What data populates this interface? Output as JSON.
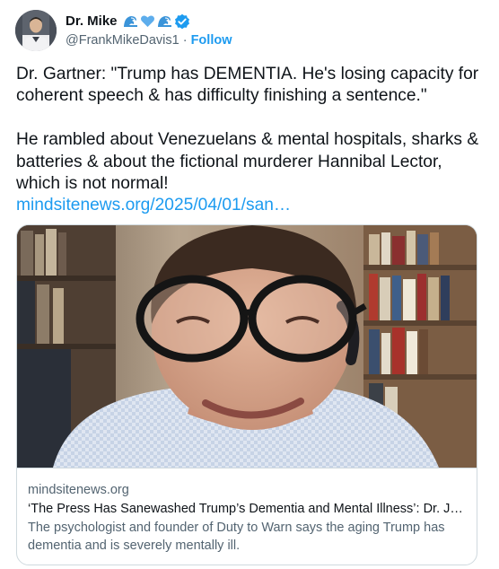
{
  "author": {
    "display_name": "Dr. Mike",
    "handle": "@FrankMikeDavis1",
    "separator": "·",
    "follow_label": "Follow",
    "avatar_icon": "profile-photo",
    "name_emojis": [
      "wave-emoji",
      "blue-heart-emoji",
      "wave-emoji"
    ],
    "verified_icon": "verified-badge-icon"
  },
  "tweet": {
    "paragraph1": "Dr. Gartner: \"Trump has DEMENTIA. He's losing capacity for coherent speech & has difficulty finishing a sentence.\"",
    "paragraph2": "He rambled about Venezuelans & mental hospitals, sharks &  batteries & about the fictional murderer Hannibal Lector, which is not normal!",
    "link_text": "mindsitenews.org/2025/04/01/san…"
  },
  "card": {
    "image_icon": "video-call-photo",
    "domain": "mindsitenews.org",
    "title": "‘The Press Has Sanewashed Trump’s Dementia and Mental Illness’: Dr. Jo…",
    "description": "The psychologist and founder of Duty to Warn says the aging Trump has dementia and is severely mentally ill."
  },
  "colors": {
    "link_blue": "#1d9bf0",
    "text_primary": "#0f1419",
    "text_secondary": "#536471",
    "border": "#cfd9de"
  }
}
